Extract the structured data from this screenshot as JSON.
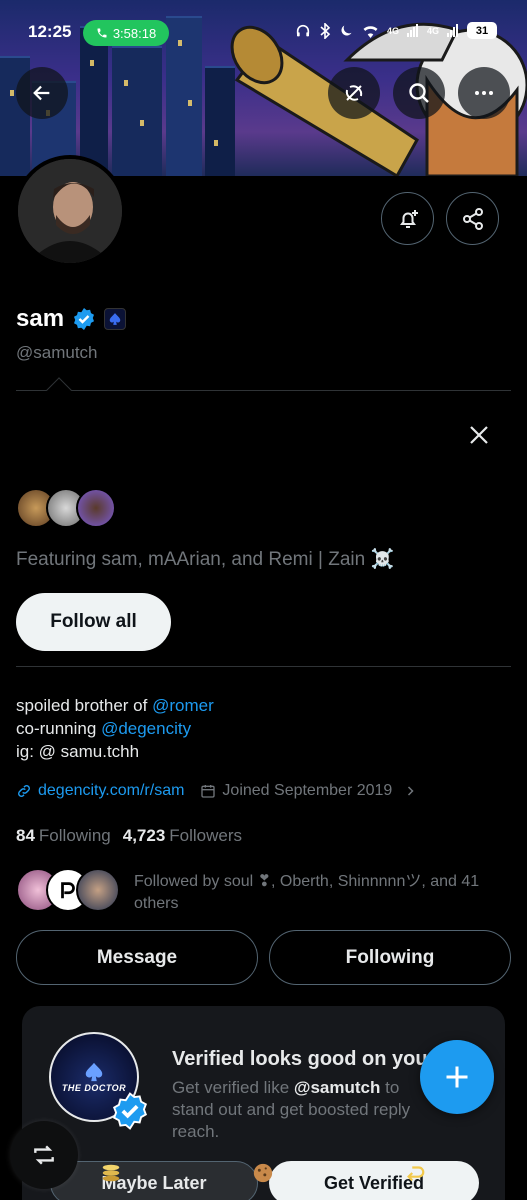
{
  "status_bar": {
    "time": "12:25",
    "call_timer": "3:58:18",
    "network_1": "4G",
    "network_2": "4G",
    "battery": "31"
  },
  "profile": {
    "name": "sam",
    "handle": "@samutch",
    "bio_line1_prefix": "spoiled brother of ",
    "bio_line1_mention": "@romer",
    "bio_line2_prefix": "co-running ",
    "bio_line2_mention": "@degencity",
    "bio_line3": "ig: @ samu.tchh",
    "website": "degencity.com/r/sam",
    "joined": "Joined September 2019",
    "following_count": "84",
    "following_label": "Following",
    "followers_count": "4,723",
    "followers_label": "Followers",
    "followed_by": "Followed by soul ❣, Oberth, Shinnnnnツ, and 41 others"
  },
  "suggestions": {
    "featuring": "Featuring sam, mAArian, and Remi | Zain ☠️",
    "follow_all": "Follow all"
  },
  "actions": {
    "message": "Message",
    "following": "Following"
  },
  "verified_card": {
    "badge_label": "THE DOCTOR",
    "title": "Verified looks good on you",
    "desc_prefix": "Get verified like ",
    "desc_handle": "@samutch",
    "desc_suffix": " to stand out and get boosted reply reach.",
    "maybe_later": "Maybe Later",
    "get_verified": "Get Verified"
  },
  "colors": {
    "accent": "#1d9bf0",
    "background": "#000000",
    "muted": "#71767b",
    "call_pill": "#22c55e"
  }
}
